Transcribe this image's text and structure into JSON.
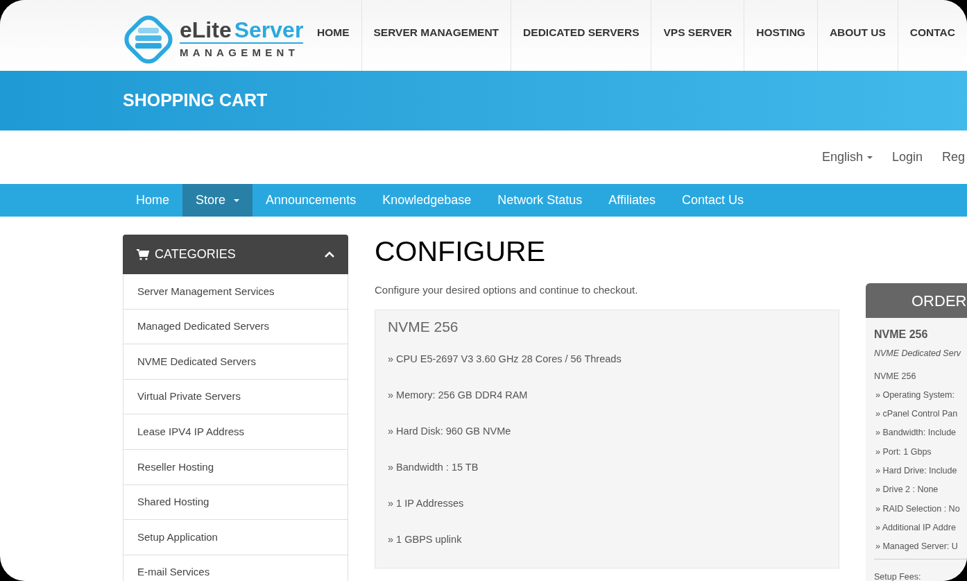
{
  "logo": {
    "word_1": "eLite",
    "word_2": "Server",
    "tagline": "MANAGEMENT"
  },
  "top_nav": [
    "HOME",
    "SERVER MANAGEMENT",
    "DEDICATED SERVERS",
    "VPS SERVER",
    "HOSTING",
    "ABOUT US",
    "CONTAC"
  ],
  "banner": {
    "title": "SHOPPING CART"
  },
  "utility_links": [
    {
      "label": "English",
      "kind": "dropdown"
    },
    {
      "label": "Login",
      "kind": "link"
    },
    {
      "label": "Reg",
      "kind": "link"
    }
  ],
  "main_nav": [
    {
      "label": "Home",
      "selected": false,
      "dropdown": false
    },
    {
      "label": "Store",
      "selected": true,
      "dropdown": true
    },
    {
      "label": "Announcements",
      "selected": false,
      "dropdown": false
    },
    {
      "label": "Knowledgebase",
      "selected": false,
      "dropdown": false
    },
    {
      "label": "Network Status",
      "selected": false,
      "dropdown": false
    },
    {
      "label": "Affiliates",
      "selected": false,
      "dropdown": false
    },
    {
      "label": "Contact Us",
      "selected": false,
      "dropdown": false
    }
  ],
  "sidebar": {
    "title": "CATEGORIES",
    "expanded": true,
    "items": [
      "Server Management Services",
      "Managed Dedicated Servers",
      "NVME Dedicated Servers",
      "Virtual Private Servers",
      "Lease IPV4 IP Address",
      "Reseller Hosting",
      "Shared Hosting",
      "Setup Application",
      "E-mail Services"
    ]
  },
  "configure": {
    "title": "CONFIGURE",
    "subtitle": "Configure your desired options and continue to checkout.",
    "product": "NVME 256",
    "features": [
      "» CPU E5-2697 V3 3.60 GHz 28 Cores / 56 Threads",
      "» Memory: 256 GB DDR4 RAM",
      "» Hard Disk: 960 GB NVMe",
      "» Bandwidth : 15 TB",
      "» 1 IP Addresses",
      "» 1 GBPS uplink"
    ]
  },
  "order_summary": {
    "title": "ORDER",
    "product": "NVME 256",
    "group": "NVME Dedicated Serv",
    "line": "NVME 256",
    "options": [
      "» Operating System:",
      "» cPanel Control Pan",
      "» Bandwidth: Include",
      "» Port: 1 Gbps",
      "» Hard Drive: Include",
      "» Drive 2 : None",
      "» RAID Selection : No",
      "» Additional IP Addre",
      "» Managed Server: U"
    ],
    "fees_label": "Setup Fees:"
  }
}
